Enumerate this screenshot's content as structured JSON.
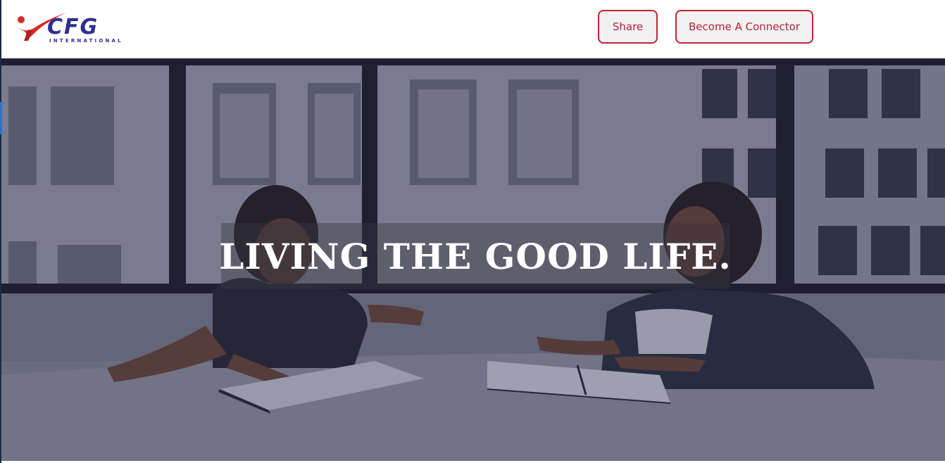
{
  "header": {
    "logo": {
      "text": "CFG",
      "subtext": "INTERNATIONAL",
      "icon": "swoosh-person-icon",
      "colors": {
        "primary": "#2e2f8f",
        "accent": "#d42a2a"
      }
    },
    "buttons": {
      "share_label": "Share",
      "connector_label": "Become A Connector"
    },
    "button_color": "#b3203a"
  },
  "hero": {
    "headline": "LIVING THE GOOD LIFE.",
    "image": "two-women-meeting-at-table-photo"
  }
}
